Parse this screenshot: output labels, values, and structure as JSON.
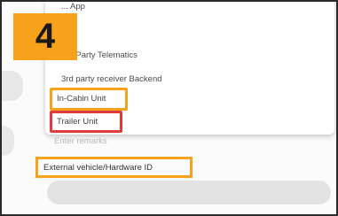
{
  "step_badge": "4",
  "dropdown": {
    "options": [
      "... App",
      "...",
      "3rd Party Telematics",
      "3rd party receiver Backend",
      "In-Cabin Unit",
      "Trailer Unit"
    ]
  },
  "remarks_placeholder": "Enter remarks",
  "external_id_label": "External vehicle/Hardware ID",
  "colors": {
    "highlight_orange": "#f7a21b",
    "highlight_red": "#e23b3b",
    "badge_orange": "#f7a21b"
  }
}
